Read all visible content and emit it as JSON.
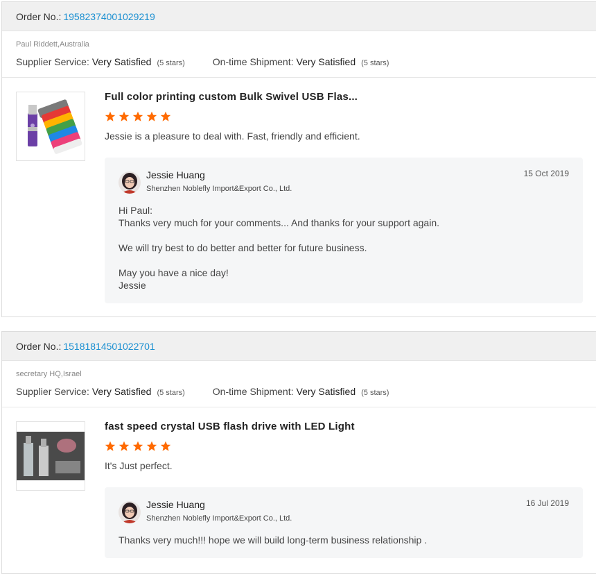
{
  "reviews": [
    {
      "order_label": "Order No.:",
      "order_no": "19582374001029219",
      "buyer": "Paul Riddett,Australia",
      "supplier_service_label": "Supplier Service:",
      "supplier_service_value": "Very Satisfied",
      "supplier_service_stars": "(5 stars)",
      "shipment_label": "On-time Shipment:",
      "shipment_value": "Very Satisfied",
      "shipment_stars": "(5 stars)",
      "product_title": "Full color printing custom Bulk Swivel USB Flas...",
      "star_rating": 5,
      "comment": "Jessie is a pleasure to deal with. Fast, friendly and efficient.",
      "reply": {
        "name": "Jessie Huang",
        "company": "Shenzhen Noblefly Import&Export Co., Ltd.",
        "date": "15 Oct 2019",
        "lines": [
          "Hi Paul:",
          "Thanks very much for your comments... And thanks for your support again.",
          "",
          "We will try best to do better and better for future business.",
          "",
          "May you have a nice day!",
          "Jessie"
        ]
      }
    },
    {
      "order_label": "Order No.:",
      "order_no": "15181814501022701",
      "buyer": "secretary HQ,Israel",
      "supplier_service_label": "Supplier Service:",
      "supplier_service_value": "Very Satisfied",
      "supplier_service_stars": "(5 stars)",
      "shipment_label": "On-time Shipment:",
      "shipment_value": "Very Satisfied",
      "shipment_stars": "(5 stars)",
      "product_title": "fast speed crystal USB flash drive with LED Light",
      "star_rating": 5,
      "comment": "It's Just perfect.",
      "reply": {
        "name": "Jessie Huang",
        "company": "Shenzhen Noblefly Import&Export Co., Ltd.",
        "date": "16 Jul 2019",
        "lines": [
          "Thanks very much!!! hope we will build long-term business relationship ."
        ]
      }
    }
  ],
  "colors": {
    "order_link": "#1a8fd1",
    "star": "#ff6a00",
    "reply_bg": "#f5f6f7",
    "order_bar_bg": "#f0f0f0"
  },
  "icons": {
    "star": "star-icon",
    "avatar": "avatar-icon"
  }
}
